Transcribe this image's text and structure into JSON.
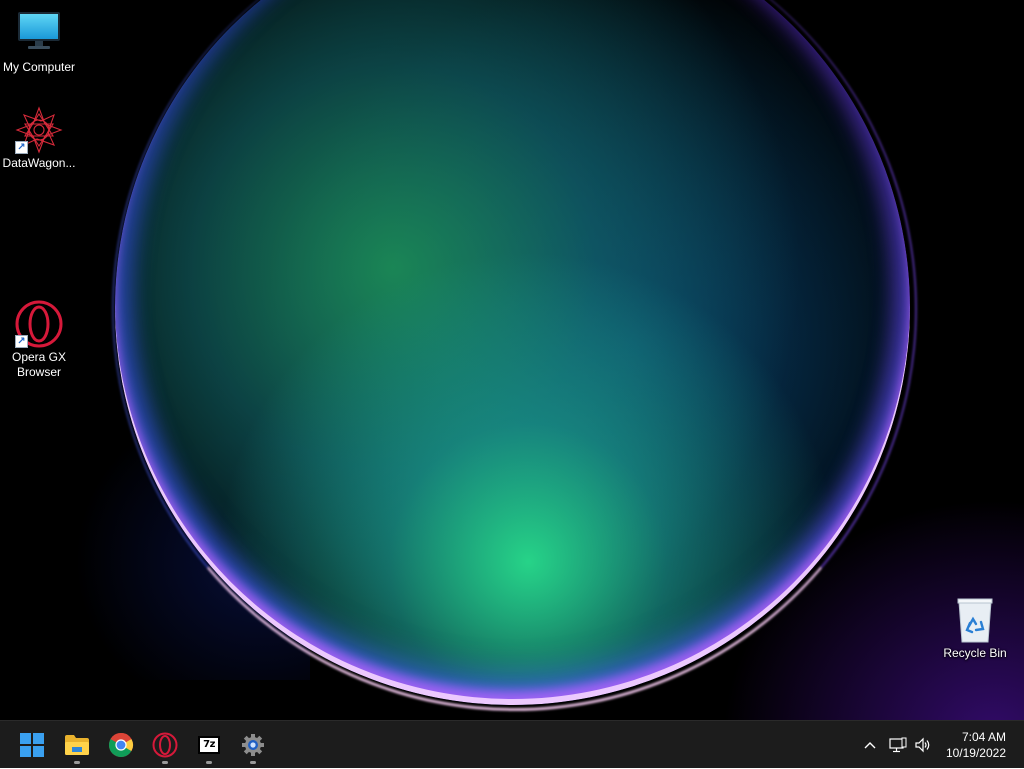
{
  "desktop": {
    "icons": [
      {
        "label": "My Computer",
        "icon": "monitor-icon"
      },
      {
        "label": "DataWagon...",
        "icon": "datawagon-icon"
      },
      {
        "label": "Opera GX Browser",
        "icon": "opera-gx-icon"
      },
      {
        "label": "Recycle Bin",
        "icon": "recycle-bin-icon"
      }
    ]
  },
  "taskbar": {
    "apps": [
      {
        "name": "Start",
        "icon": "windows-start-icon",
        "running": false
      },
      {
        "name": "File Explorer",
        "icon": "folder-icon",
        "running": true
      },
      {
        "name": "Google Chrome",
        "icon": "chrome-icon",
        "running": false
      },
      {
        "name": "Opera GX",
        "icon": "opera-gx-icon",
        "running": true
      },
      {
        "name": "7-Zip",
        "icon": "7zip-icon",
        "running": true,
        "glyph": "7z"
      },
      {
        "name": "Settings",
        "icon": "settings-gear-icon",
        "running": true
      }
    ],
    "tray": {
      "icons": [
        "chevron-up-icon",
        "network-icon",
        "volume-icon"
      ],
      "time": "7:04 AM",
      "date": "10/19/2022"
    }
  },
  "colors": {
    "taskbar_bg": "#1c1c1c",
    "opera_red": "#d6193a",
    "windows_blue": "#3aa0f0"
  }
}
